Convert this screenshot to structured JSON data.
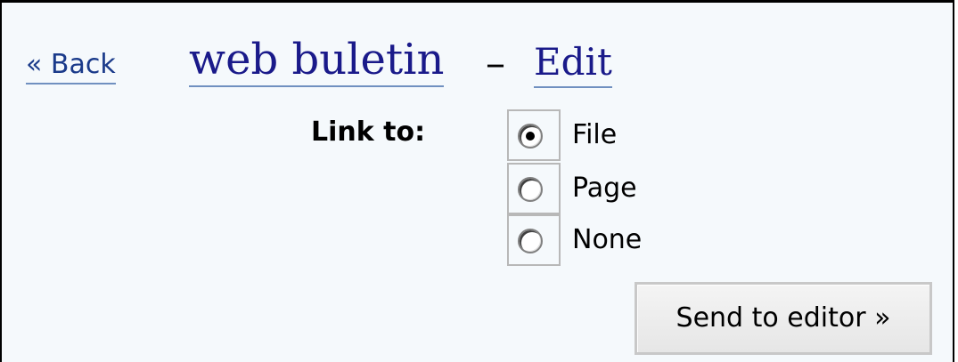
{
  "header": {
    "back_label": "« Back",
    "title": "web buletin",
    "separator": "–",
    "edit_label": "Edit"
  },
  "link_to": {
    "label": "Link to:",
    "options": [
      {
        "label": "File",
        "checked": true
      },
      {
        "label": "Page",
        "checked": false
      },
      {
        "label": "None",
        "checked": false
      }
    ]
  },
  "actions": {
    "send_label": "Send to editor »"
  },
  "colors": {
    "link": "#1a1a8a",
    "underline": "#7090c0",
    "background": "#f5f9fc"
  }
}
